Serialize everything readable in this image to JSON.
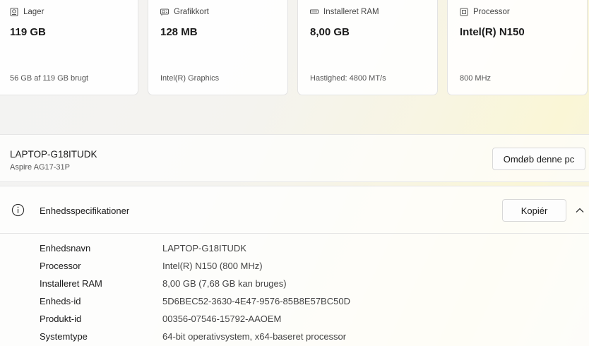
{
  "cards": [
    {
      "icon": "storage-icon",
      "title": "Lager",
      "value": "119 GB",
      "sub": "56 GB af 119 GB brugt"
    },
    {
      "icon": "graphics-card-icon",
      "title": "Grafikkort",
      "value": "128 MB",
      "sub": "Intel(R) Graphics"
    },
    {
      "icon": "ram-icon",
      "title": "Installeret RAM",
      "value": "8,00 GB",
      "sub": "Hastighed: 4800 MT/s"
    },
    {
      "icon": "processor-icon",
      "title": "Processor",
      "value": "Intel(R) N150",
      "sub": "800 MHz"
    }
  ],
  "device": {
    "name": "LAPTOP-G18ITUDK",
    "model": "Aspire AG17-31P",
    "rename_label": "Omdøb denne pc"
  },
  "specs": {
    "title": "Enhedsspecifikationer",
    "copy_label": "Kopiér",
    "rows": [
      {
        "label": "Enhedsnavn",
        "value": "LAPTOP-G18ITUDK"
      },
      {
        "label": "Processor",
        "value": "Intel(R) N150 (800 MHz)"
      },
      {
        "label": "Installeret RAM",
        "value": "8,00 GB (7,68 GB kan bruges)"
      },
      {
        "label": "Enheds-id",
        "value": "5D6BEC52-3630-4E47-9576-85B8E57BC50D"
      },
      {
        "label": "Produkt-id",
        "value": "00356-07546-15792-AAOEM"
      },
      {
        "label": "Systemtype",
        "value": "64-bit operativsystem, x64-baseret processor"
      }
    ]
  },
  "colors": {
    "text": "#1b1b1b",
    "secondary_text": "#555555",
    "accent_glow": "#faf6d6"
  }
}
